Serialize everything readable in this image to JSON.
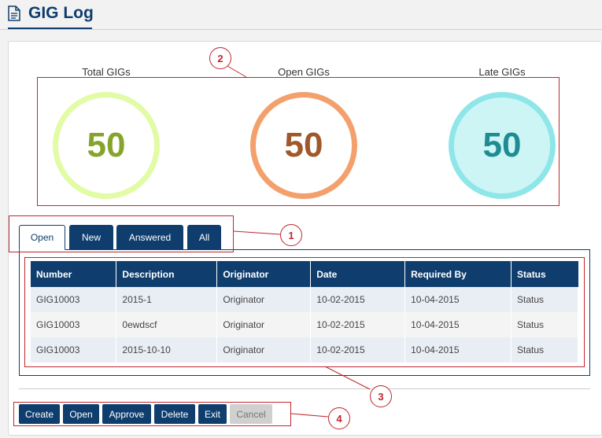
{
  "header": {
    "title": "GIG Log",
    "icon": "document-icon"
  },
  "stats": [
    {
      "label": "Total GIGs",
      "value": "50"
    },
    {
      "label": "Open GIGs",
      "value": "50"
    },
    {
      "label": "Late GIGs",
      "value": "50"
    }
  ],
  "tabs": [
    {
      "label": "Open",
      "active": true
    },
    {
      "label": "New"
    },
    {
      "label": "Answered"
    },
    {
      "label": "All"
    }
  ],
  "table": {
    "columns": [
      "Number",
      "Description",
      "Originator",
      "Date",
      "Required By",
      "Status"
    ],
    "rows": [
      [
        "GIG10003",
        "2015-1",
        "Originator",
        "10-02-2015",
        "10-04-2015",
        "Status"
      ],
      [
        "GIG10003",
        "0ewdscf",
        "Originator",
        "10-02-2015",
        "10-04-2015",
        "Status"
      ],
      [
        "GIG10003",
        "2015-10-10",
        "Originator",
        "10-02-2015",
        "10-04-2015",
        "Status"
      ]
    ]
  },
  "actions": [
    {
      "label": "Create"
    },
    {
      "label": "Open"
    },
    {
      "label": "Approve"
    },
    {
      "label": "Delete"
    },
    {
      "label": "Exit"
    },
    {
      "label": "Cancel",
      "disabled": true
    }
  ],
  "annotations": [
    "1",
    "2",
    "3",
    "4"
  ],
  "colors": {
    "primary": "#0f3e6e",
    "annotation": "#c0262e",
    "total_ring": "#e2fba5",
    "open_ring": "#f3a06c",
    "late_ring": "#8fe6e8"
  }
}
